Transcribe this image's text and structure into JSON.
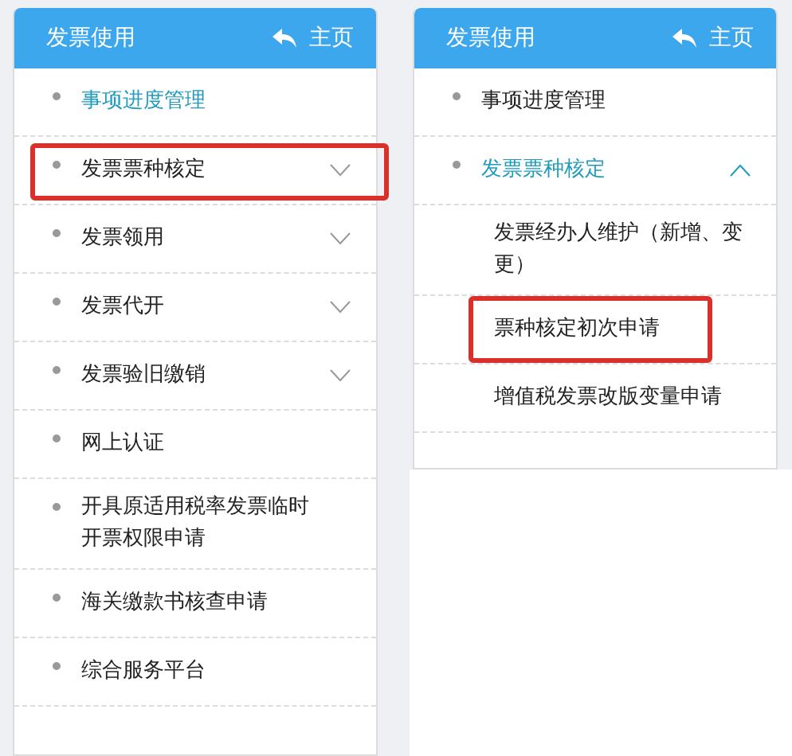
{
  "panels": [
    {
      "title": "发票使用",
      "home": "主页",
      "items": [
        {
          "kind": "item",
          "label": "事项进度管理",
          "selected": true,
          "highlighted": false
        },
        {
          "kind": "group",
          "label": "发票票种核定",
          "selected": false,
          "expanded": false,
          "highlighted": true
        },
        {
          "kind": "group",
          "label": "发票领用",
          "selected": false,
          "expanded": false,
          "highlighted": false
        },
        {
          "kind": "group",
          "label": "发票代开",
          "selected": false,
          "expanded": false,
          "highlighted": false
        },
        {
          "kind": "group",
          "label": "发票验旧缴销",
          "selected": false,
          "expanded": false,
          "highlighted": false
        },
        {
          "kind": "item",
          "label": "网上认证",
          "selected": false,
          "highlighted": false
        },
        {
          "kind": "item",
          "label": "开具原适用税率发票临时开票权限申请",
          "selected": false,
          "highlighted": false
        },
        {
          "kind": "item",
          "label": "海关缴款书核查申请",
          "selected": false,
          "highlighted": false
        },
        {
          "kind": "item",
          "label": "综合服务平台",
          "selected": false,
          "highlighted": false
        }
      ]
    },
    {
      "title": "发票使用",
      "home": "主页",
      "items": [
        {
          "kind": "item",
          "label": "事项进度管理",
          "selected": false,
          "highlighted": false
        },
        {
          "kind": "group",
          "label": "发票票种核定",
          "selected": true,
          "expanded": true,
          "highlighted": false
        },
        {
          "kind": "sub",
          "label": "发票经办人维护（新增、变更）",
          "selected": false,
          "highlighted": false
        },
        {
          "kind": "sub",
          "label": "票种核定初次申请",
          "selected": false,
          "highlighted": true
        },
        {
          "kind": "sub",
          "label": "增值税发票改版变量申请",
          "selected": false,
          "highlighted": false
        }
      ]
    }
  ]
}
